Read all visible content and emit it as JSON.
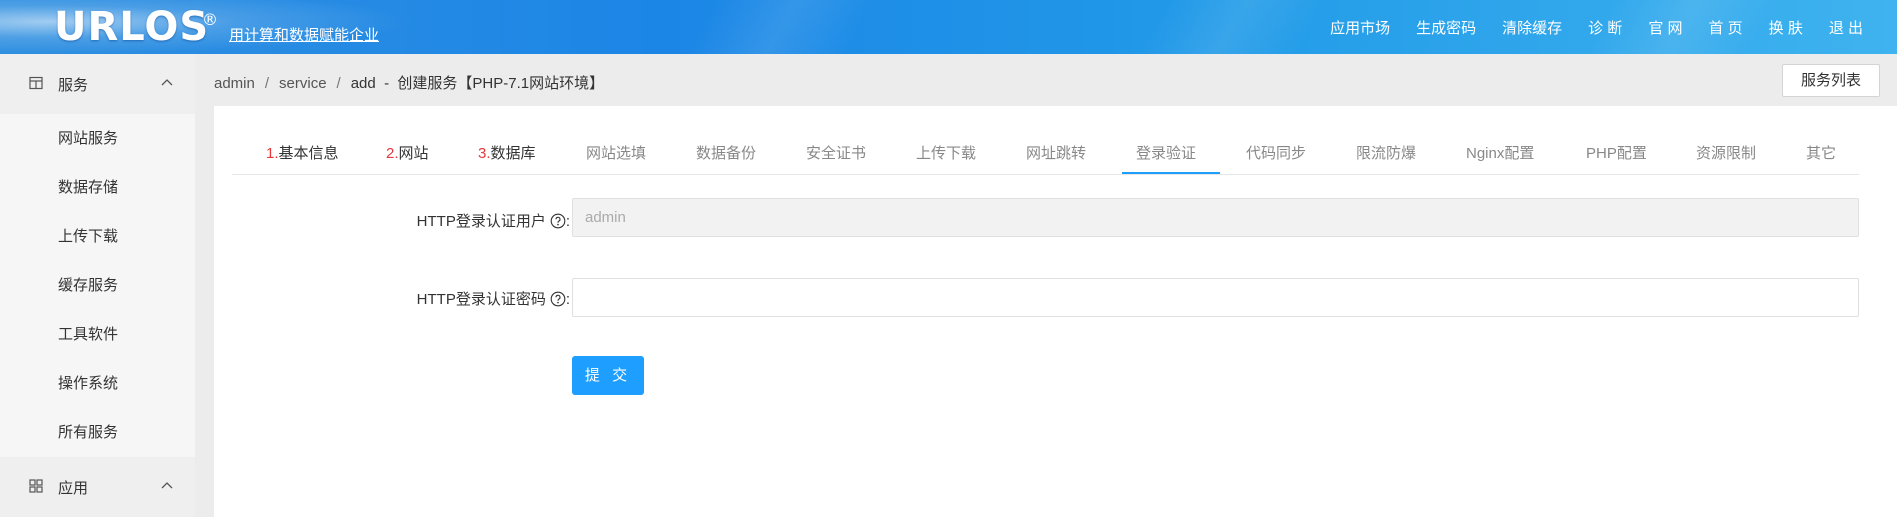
{
  "header": {
    "logo": "URLOS",
    "logo_reg": "®",
    "slogan": "用计算和数据赋能企业",
    "nav": [
      "应用市场",
      "生成密码",
      "清除缓存",
      "诊 断",
      "官 网",
      "首 页",
      "换 肤",
      "退 出"
    ]
  },
  "sidebar": {
    "group_service": "服务",
    "items": [
      "网站服务",
      "数据存储",
      "上传下载",
      "缓存服务",
      "工具软件",
      "操作系统",
      "所有服务"
    ],
    "group_app": "应用"
  },
  "breadcrumb": {
    "parts": [
      "admin",
      "service",
      "add"
    ],
    "current": "创建服务【PHP-7.1网站环境】"
  },
  "list_button": "服务列表",
  "tabs": [
    {
      "num": "1.",
      "label": "基本信息"
    },
    {
      "num": "2.",
      "label": "网站"
    },
    {
      "num": "3.",
      "label": "数据库"
    },
    {
      "num": "",
      "label": "网站选填"
    },
    {
      "num": "",
      "label": "数据备份"
    },
    {
      "num": "",
      "label": "安全证书"
    },
    {
      "num": "",
      "label": "上传下载"
    },
    {
      "num": "",
      "label": "网址跳转"
    },
    {
      "num": "",
      "label": "登录验证"
    },
    {
      "num": "",
      "label": "代码同步"
    },
    {
      "num": "",
      "label": "限流防爆"
    },
    {
      "num": "",
      "label": "Nginx配置"
    },
    {
      "num": "",
      "label": "PHP配置"
    },
    {
      "num": "",
      "label": "资源限制"
    },
    {
      "num": "",
      "label": "其它"
    }
  ],
  "form": {
    "user_label": "HTTP登录认证用户",
    "user_value": "admin",
    "password_label": "HTTP登录认证密码",
    "password_value": "",
    "colon": ":",
    "submit": "提 交"
  },
  "colors": {
    "accent": "#1e9fff",
    "step_number": "#e4393c"
  }
}
